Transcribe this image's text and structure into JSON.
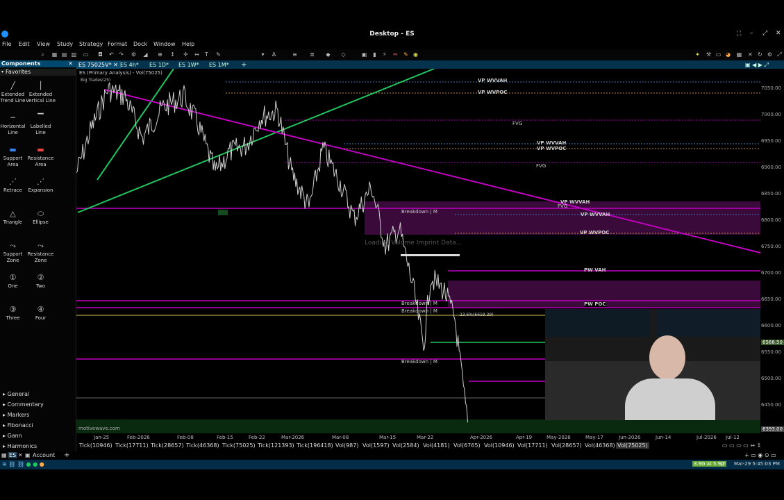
{
  "window": {
    "title": "Desktop - ES"
  },
  "menu": [
    "File",
    "Edit",
    "View",
    "Study",
    "Strategy",
    "Format",
    "Dock",
    "Window",
    "Help"
  ],
  "toolbar": {
    "symbol": "ES",
    "bar_type": "Vol(75025)"
  },
  "sidebar": {
    "title": "Components",
    "favorites_label": "Favorites",
    "tools": [
      {
        "label": "Extended Trend Line",
        "icon": "trend-line-icon"
      },
      {
        "label": "Extended Vertical Line",
        "icon": "vertical-line-icon"
      },
      {
        "label": "Horizontal Line",
        "icon": "horizontal-line-icon"
      },
      {
        "label": "Labelled Line",
        "icon": "labelled-line-icon"
      },
      {
        "label": "Support Area",
        "icon": "support-area-icon"
      },
      {
        "label": "Resistance Area",
        "icon": "resistance-area-icon"
      },
      {
        "label": "Retrace",
        "icon": "retrace-icon"
      },
      {
        "label": "Expansion",
        "icon": "expansion-icon"
      },
      {
        "label": "Triangle",
        "icon": "triangle-icon"
      },
      {
        "label": "Ellipse",
        "icon": "ellipse-icon"
      },
      {
        "label": "Support Zone",
        "icon": "support-zone-icon"
      },
      {
        "label": "Resistance Zone",
        "icon": "resistance-zone-icon"
      },
      {
        "label": "One",
        "icon": "one-icon"
      },
      {
        "label": "Two",
        "icon": "two-icon"
      },
      {
        "label": "Three",
        "icon": "three-icon"
      },
      {
        "label": "Four",
        "icon": "four-icon"
      }
    ],
    "categories": [
      "General",
      "Commentary",
      "Markers",
      "Fibonacci",
      "Gann",
      "Harmonics"
    ]
  },
  "tabs": [
    "ES 75025V*",
    "ES 4h*",
    "ES 1D*",
    "ES 1W*",
    "ES 1M*"
  ],
  "chart": {
    "title": "ES (Primary Analysis) - Vol(75025)",
    "study_label": "Big Trades(25)",
    "watermark": "motivewave.com",
    "loading_text": "Loading Volume Imprint Data...",
    "price_labels": [
      "7050.00",
      "7000.00",
      "6950.00",
      "6900.00",
      "6850.00",
      "6800.00",
      "6750.00",
      "6700.00",
      "6650.00",
      "6600.00",
      "6550.00",
      "6500.00",
      "6450.00"
    ],
    "last_price": "6568.50",
    "last_price_low": "6393.00",
    "date_labels": [
      "Jan-25",
      "Feb-2026",
      "Feb-08",
      "Feb-15",
      "Feb-22",
      "Mar-2026",
      "Mar-08",
      "Mar-15",
      "Mar-22",
      "Apr-2026",
      "Apr-19",
      "May-2026",
      "May-17",
      "Jun-2026",
      "Jun-14",
      "Jul-2026",
      "Jul-12"
    ],
    "annotations": {
      "vp_wvvah_1": "VP WVVAH",
      "vp_wvpoc_1": "VP WVPOC",
      "fvg_1": "FVG",
      "vp_wvvah_2": "VP WVVAH",
      "vp_wvpoc_2": "VP WVPOC",
      "fvg_2": "FVG",
      "vp_wvvah_3": "VP WVVAH",
      "fvg_3": "FVG",
      "vp_wvvah_4": "VP WVVAH",
      "vp_wvpoc_3": "VP WVPOC",
      "pw_vah": "PW VAH",
      "pw_poc": "PW POC",
      "breakdown_1": "Breakdown | M",
      "breakdown_2": "Breakdown | M",
      "breakdown_3": "Breakdown | M",
      "breakdown_4": "Breakdown | M",
      "fib": "23.6%(6619.29)"
    }
  },
  "bottom_tabs": [
    "Tick(10946)",
    "Tick(17711)",
    "Tick(28657)",
    "Tick(46368)",
    "Tick(75025)",
    "Tick(121393)",
    "Tick(196418)",
    "Vol(987)",
    "Vol(1597)",
    "Vol(2584)",
    "Vol(4181)",
    "Vol(6765)",
    "Vol(10946)",
    "Vol(17711)",
    "Vol(28657)",
    "Vol(46368)",
    "Vol(75025)"
  ],
  "workspace": {
    "tab1": "ES",
    "tab2": "Account"
  },
  "status": {
    "feed": "3.9G at 5.9G",
    "datetime": "Mar-29 5:45:03 PM"
  },
  "colors": {
    "accent": "#00486e",
    "magenta": "#b000b0",
    "green": "#22c55e",
    "fvg_fill": "#3a0a3a"
  }
}
